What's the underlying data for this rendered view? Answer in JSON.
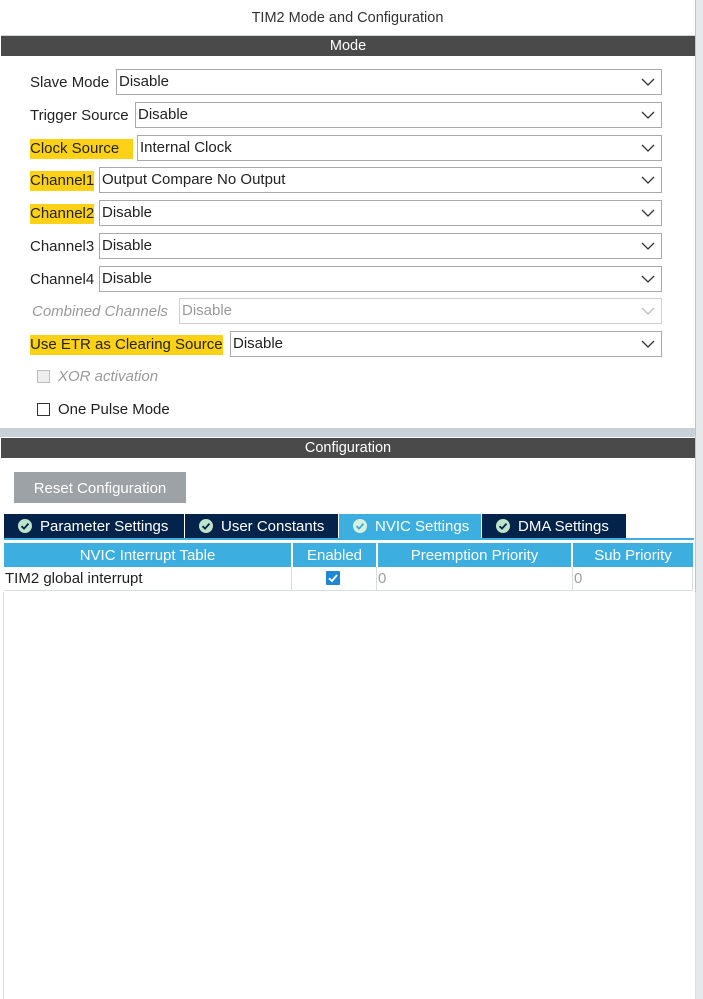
{
  "window": {
    "title": "TIM2 Mode and Configuration"
  },
  "mode": {
    "header": "Mode",
    "fields": [
      {
        "label": "Slave Mode",
        "value": "Disable",
        "highlight": false,
        "disabled": false
      },
      {
        "label": "Trigger Source",
        "value": "Disable",
        "highlight": false,
        "disabled": false
      },
      {
        "label": "Clock Source",
        "value": "Internal Clock",
        "highlight": true,
        "disabled": false
      },
      {
        "label": "Channel1",
        "value": "Output Compare No Output",
        "highlight": true,
        "disabled": false
      },
      {
        "label": "Channel2",
        "value": "Disable",
        "highlight": true,
        "disabled": false
      },
      {
        "label": "Channel3",
        "value": "Disable",
        "highlight": false,
        "disabled": false
      },
      {
        "label": "Channel4",
        "value": "Disable",
        "highlight": false,
        "disabled": false
      },
      {
        "label": "Combined Channels",
        "value": "Disable",
        "highlight": false,
        "disabled": true
      },
      {
        "label": "Use ETR as Clearing Source",
        "value": "Disable",
        "highlight": true,
        "disabled": false
      }
    ],
    "checkboxes": [
      {
        "label": "XOR activation",
        "checked": false,
        "disabled": true
      },
      {
        "label": "One Pulse Mode",
        "checked": false,
        "disabled": false
      }
    ]
  },
  "configuration": {
    "header": "Configuration",
    "reset_label": "Reset Configuration",
    "tabs": [
      {
        "label": "Parameter Settings",
        "active": false
      },
      {
        "label": "User Constants",
        "active": false
      },
      {
        "label": "NVIC Settings",
        "active": true
      },
      {
        "label": "DMA Settings",
        "active": false
      }
    ],
    "table": {
      "headers": [
        "NVIC Interrupt Table",
        "Enabled",
        "Preemption Priority",
        "Sub Priority"
      ],
      "rows": [
        {
          "name": "TIM2 global interrupt",
          "enabled": true,
          "preemption": "0",
          "sub": "0"
        }
      ]
    }
  },
  "colors": {
    "highlight": "#fcd116",
    "section_header": "#4a4a4a",
    "tab_dark": "#03234b",
    "tab_active": "#3caee0",
    "checkbox_checked": "#1e88d4",
    "button": "#9da2a6"
  },
  "icons": {
    "tab_icon": "check-circle-icon",
    "dropdown": "chevron-down-icon"
  }
}
